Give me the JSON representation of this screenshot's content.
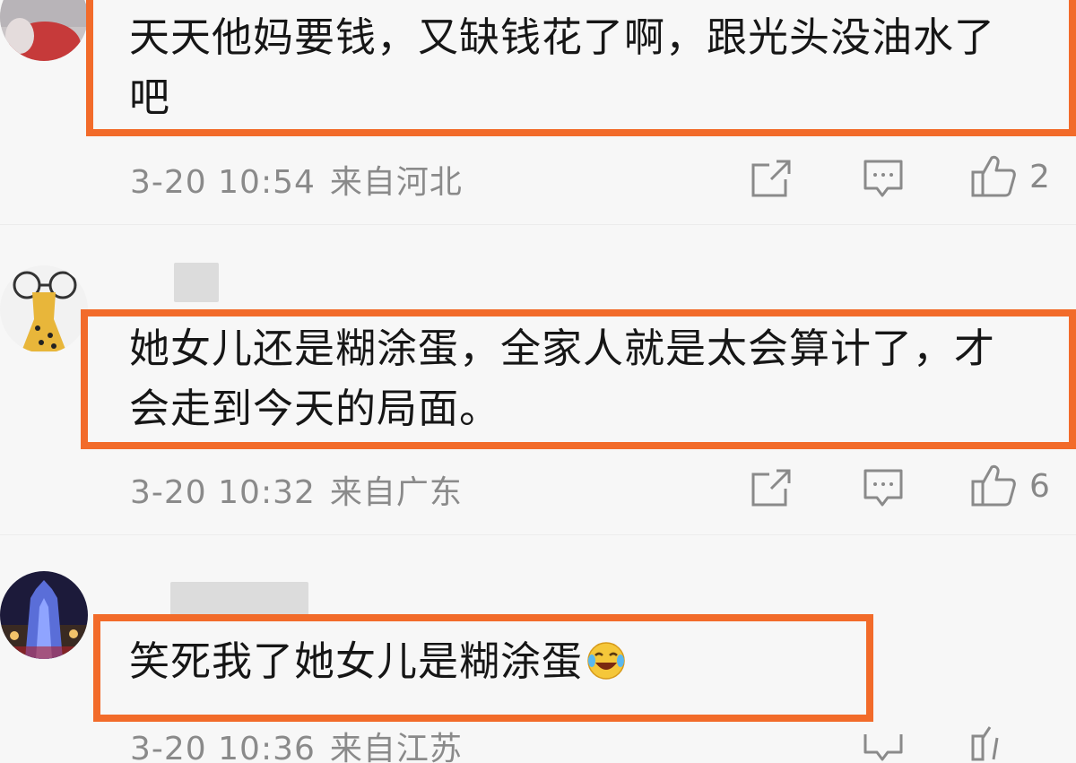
{
  "comments": [
    {
      "text": "天天他妈要钱，又缺钱花了啊，跟光头没油水了吧",
      "time": "3-20 10:54",
      "location": "来自河北",
      "likes": "2"
    },
    {
      "text": "她女儿还是糊涂蛋，全家人就是太会算计了，才会走到今天的局面。",
      "time": "3-20 10:32",
      "location": "来自广东",
      "likes": "6"
    },
    {
      "text": "笑死我了她女儿是糊涂蛋",
      "time": "3-20 10:36",
      "location": "来自江苏",
      "likes": ""
    }
  ],
  "icons": {
    "share": "share-icon",
    "comment": "comment-icon",
    "like": "like-icon",
    "emoji": "laugh-cry-emoji-icon"
  },
  "colors": {
    "highlight_border": "#f26b2a",
    "meta_text": "#8a8a8a",
    "body_text": "#161616",
    "background": "#f7f7f7"
  }
}
